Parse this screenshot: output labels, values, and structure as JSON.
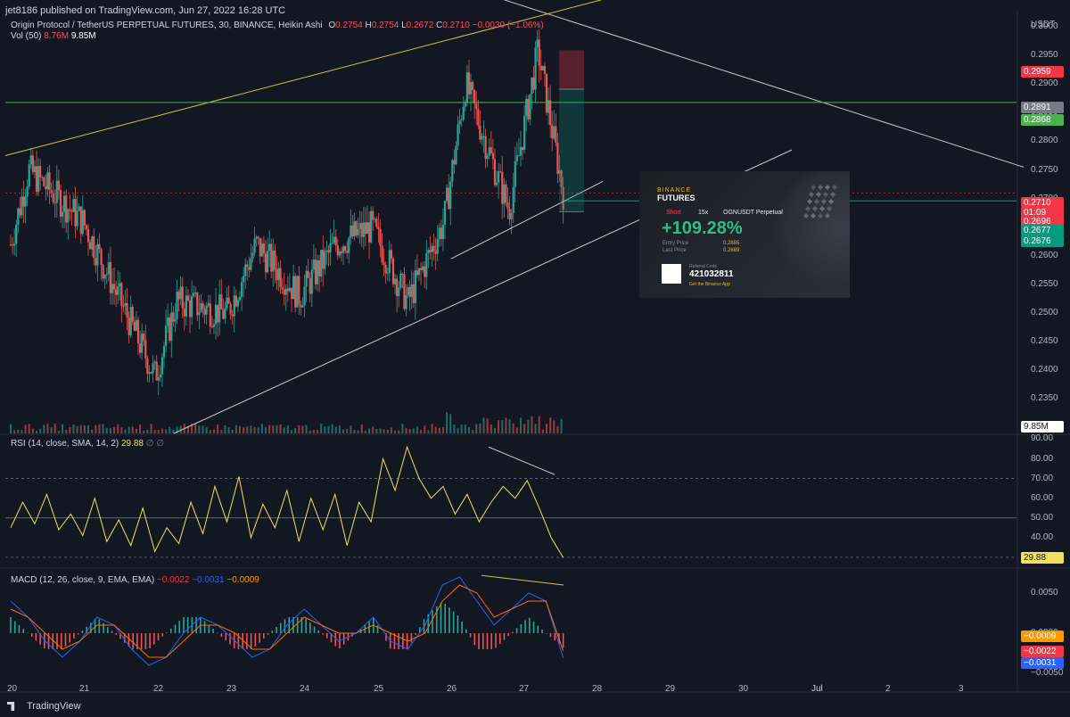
{
  "header": {
    "publisher": "jet8186 published on TradingView.com, Jun 27, 2022 16:28 UTC"
  },
  "legend": {
    "title": "Origin Protocol / TetherUS PERPETUAL FUTURES, 30, BINANCE, Heikin Ashi",
    "o_label": "O",
    "o_value": "0.2754",
    "h_label": "H",
    "h_value": "0.2754",
    "l_label": "L",
    "l_value": "0.2672",
    "c_label": "C",
    "c_value": "0.2710",
    "change": "−0.0030 (−1.06%)",
    "vol_label": "Vol (50)",
    "vol_value1": "8.76M",
    "vol_value2": "9.85M"
  },
  "rsi_legend": {
    "label": "RSI (14, close, SMA, 14, 2)",
    "value": "29.88",
    "extra": "∅ ∅"
  },
  "macd_legend": {
    "label": "MACD (12, 26, close, 9, EMA, EMA)",
    "v1": "−0.0022",
    "v2": "−0.0031",
    "v3": "−0.0009"
  },
  "price_axis": {
    "unit": "USDT",
    "ticks": [
      "0.3000",
      "0.2950",
      "0.2900",
      "0.2850",
      "0.2800",
      "0.2750",
      "0.2700",
      "0.2650",
      "0.2600",
      "0.2550",
      "0.2500",
      "0.2450",
      "0.2400",
      "0.2350",
      "0.2300"
    ],
    "labels": [
      {
        "text": "0.2959",
        "color": "#f23645"
      },
      {
        "text": "0.2891",
        "color": "#787b86"
      },
      {
        "text": "0.2868",
        "color": "#4caf50"
      },
      {
        "text": "0.2710",
        "color": "#f23645"
      },
      {
        "text": "01:09",
        "color": "#f23645"
      },
      {
        "text": "0.2696",
        "color": "#f23645"
      },
      {
        "text": "0.2677",
        "color": "#089981"
      },
      {
        "text": "0.2676",
        "color": "#089981"
      },
      {
        "text": "9.85M",
        "color": "#ffffff"
      }
    ]
  },
  "rsi_axis": {
    "ticks": [
      "90.00",
      "80.00",
      "70.00",
      "60.00",
      "50.00",
      "40.00",
      "30.00"
    ],
    "current": "29.88"
  },
  "macd_axis": {
    "ticks": [
      "0.0050",
      "0.0000",
      "−0.0050"
    ],
    "labels": [
      {
        "text": "−0.0009",
        "color": "#ff9800"
      },
      {
        "text": "−0.0022",
        "color": "#f23645"
      },
      {
        "text": "−0.0031",
        "color": "#2962ff"
      }
    ]
  },
  "time_axis": {
    "ticks": [
      "20",
      "21",
      "22",
      "23",
      "24",
      "25",
      "26",
      "27",
      "28",
      "29",
      "30",
      "Jul",
      "2",
      "3"
    ]
  },
  "binance_card": {
    "brand_small": "BINANCE",
    "brand_big": "FUTURES",
    "side": "Short",
    "leverage": "15x",
    "symbol": "OGNUSDT Perpetual",
    "pnl": "+109.28%",
    "entry_label": "Entry Price",
    "entry_value": "0.2885",
    "last_label": "Last Price",
    "last_value": "0.2689",
    "referral_label": "Referral Code",
    "referral_code": "421032811",
    "app_text": "Get the Binance App"
  },
  "footer": {
    "brand": "TradingView"
  },
  "colors": {
    "background": "#131722",
    "up": "#26a69a",
    "down": "#ef5350",
    "rsi": "#f0e060",
    "macd": "#2962ff",
    "signal": "#ff6d00",
    "trend_yellow": "#d4c24a",
    "trend_white": "#c8c8c8",
    "level_green": "#4caf50"
  },
  "chart_data": [
    {
      "type": "candlestick",
      "title": "Origin Protocol / TetherUS PERPETUAL FUTURES, 30, BINANCE, Heikin Ashi",
      "ylabel": "USDT",
      "ylim": [
        0.229,
        0.3025
      ],
      "x_categories": [
        "20",
        "21",
        "22",
        "23",
        "24",
        "25",
        "26",
        "27",
        "28",
        "29",
        "30",
        "Jul",
        "2",
        "3"
      ],
      "key_points": [
        {
          "x": "20",
          "y": 0.262
        },
        {
          "x": "20",
          "y": 0.275
        },
        {
          "x": "21",
          "y": 0.266
        },
        {
          "x": "21",
          "y": 0.258
        },
        {
          "x": "22",
          "y": 0.239
        },
        {
          "x": "22",
          "y": 0.252
        },
        {
          "x": "23",
          "y": 0.25
        },
        {
          "x": "23",
          "y": 0.262
        },
        {
          "x": "24",
          "y": 0.253
        },
        {
          "x": "24",
          "y": 0.262
        },
        {
          "x": "25",
          "y": 0.265
        },
        {
          "x": "25",
          "y": 0.252
        },
        {
          "x": "26",
          "y": 0.266
        },
        {
          "x": "26",
          "y": 0.29
        },
        {
          "x": "27",
          "y": 0.268
        },
        {
          "x": "27",
          "y": 0.2959
        },
        {
          "x": "27",
          "y": 0.271
        }
      ],
      "levels": [
        0.2868,
        0.2696
      ],
      "short_position": {
        "entry": 0.2891,
        "stop": 0.2959,
        "target": 0.2677
      }
    },
    {
      "type": "line",
      "title": "RSI (14, close, SMA, 14, 2)",
      "ylim": [
        25,
        92
      ],
      "bands": [
        70,
        50,
        30
      ],
      "values": [
        45,
        58,
        47,
        62,
        44,
        52,
        41,
        60,
        38,
        49,
        36,
        55,
        33,
        45,
        37,
        58,
        42,
        66,
        48,
        71,
        40,
        57,
        45,
        64,
        38,
        60,
        44,
        62,
        36,
        58,
        48,
        80,
        64,
        86,
        70,
        60,
        66,
        52,
        62,
        48,
        58,
        66,
        60,
        69,
        55,
        40,
        29.88
      ],
      "current": 29.88
    },
    {
      "type": "line",
      "title": "MACD (12, 26, close, 9, EMA, EMA)",
      "ylim": [
        -0.006,
        0.008
      ],
      "series": [
        {
          "name": "MACD",
          "values": [
            0.004,
            0.002,
            -0.001,
            -0.003,
            -0.001,
            0.002,
            0.001,
            -0.002,
            -0.004,
            -0.003,
            0.0,
            0.002,
            0.001,
            -0.001,
            -0.003,
            -0.002,
            0.001,
            0.003,
            0.001,
            -0.001,
            0.0,
            0.002,
            -0.001,
            -0.002,
            0.001,
            0.006,
            0.007,
            0.004,
            0.001,
            0.003,
            0.005,
            0.004,
            -0.0031
          ]
        },
        {
          "name": "Signal",
          "values": [
            0.003,
            0.002,
            0.0,
            -0.002,
            -0.001,
            0.001,
            0.001,
            -0.001,
            -0.003,
            -0.003,
            -0.001,
            0.001,
            0.001,
            0.0,
            -0.002,
            -0.002,
            0.0,
            0.002,
            0.001,
            0.0,
            0.0,
            0.001,
            0.0,
            -0.001,
            0.0,
            0.004,
            0.006,
            0.005,
            0.002,
            0.003,
            0.004,
            0.004,
            -0.0022
          ]
        }
      ],
      "current": {
        "macd": -0.0031,
        "signal": -0.0022,
        "histogram": -0.0009
      }
    }
  ]
}
